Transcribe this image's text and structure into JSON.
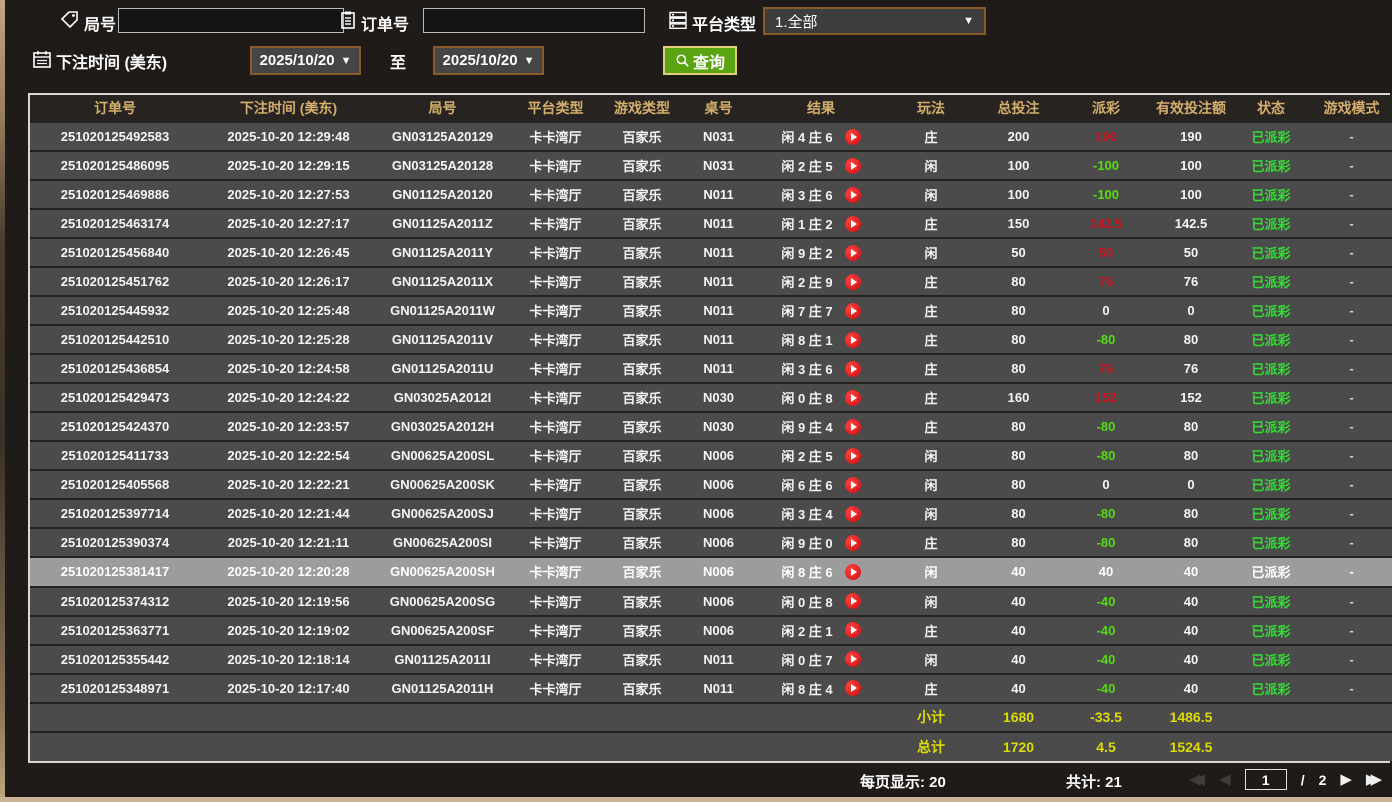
{
  "filters": {
    "round_label": "局号",
    "round_value": "",
    "order_label": "订单号",
    "order_value": "",
    "platform_label": "平台类型",
    "platform_value": "1.全部",
    "bet_time_label": "下注时间 (美东)",
    "date_from": "2025/10/20",
    "to_label": "至",
    "date_to": "2025/10/20",
    "query_label": "查询"
  },
  "table": {
    "columns": [
      "订单号",
      "下注时间 (美东)",
      "局号",
      "平台类型",
      "游戏类型",
      "桌号",
      "结果",
      "玩法",
      "总投注",
      "派彩",
      "有效投注额",
      "状态",
      "游戏模式"
    ],
    "rows": [
      {
        "order_id": "251020125492583",
        "bet_time": "2025-10-20 12:29:48",
        "round_id": "GN03125A20129",
        "platform": "卡卡湾厅",
        "game_type": "百家乐",
        "table_no": "N031",
        "result": "闲 4 庄 6",
        "play": "庄",
        "total_bet": "200",
        "payout": "190",
        "valid_bet": "190",
        "status": "已派彩",
        "game_mode": "-"
      },
      {
        "order_id": "251020125486095",
        "bet_time": "2025-10-20 12:29:15",
        "round_id": "GN03125A20128",
        "platform": "卡卡湾厅",
        "game_type": "百家乐",
        "table_no": "N031",
        "result": "闲 2 庄 5",
        "play": "闲",
        "total_bet": "100",
        "payout": "-100",
        "valid_bet": "100",
        "status": "已派彩",
        "game_mode": "-"
      },
      {
        "order_id": "251020125469886",
        "bet_time": "2025-10-20 12:27:53",
        "round_id": "GN01125A20120",
        "platform": "卡卡湾厅",
        "game_type": "百家乐",
        "table_no": "N011",
        "result": "闲 3 庄 6",
        "play": "闲",
        "total_bet": "100",
        "payout": "-100",
        "valid_bet": "100",
        "status": "已派彩",
        "game_mode": "-"
      },
      {
        "order_id": "251020125463174",
        "bet_time": "2025-10-20 12:27:17",
        "round_id": "GN01125A2011Z",
        "platform": "卡卡湾厅",
        "game_type": "百家乐",
        "table_no": "N011",
        "result": "闲 1 庄 2",
        "play": "庄",
        "total_bet": "150",
        "payout": "142.5",
        "valid_bet": "142.5",
        "status": "已派彩",
        "game_mode": "-"
      },
      {
        "order_id": "251020125456840",
        "bet_time": "2025-10-20 12:26:45",
        "round_id": "GN01125A2011Y",
        "platform": "卡卡湾厅",
        "game_type": "百家乐",
        "table_no": "N011",
        "result": "闲 9 庄 2",
        "play": "闲",
        "total_bet": "50",
        "payout": "50",
        "valid_bet": "50",
        "status": "已派彩",
        "game_mode": "-"
      },
      {
        "order_id": "251020125451762",
        "bet_time": "2025-10-20 12:26:17",
        "round_id": "GN01125A2011X",
        "platform": "卡卡湾厅",
        "game_type": "百家乐",
        "table_no": "N011",
        "result": "闲 2 庄 9",
        "play": "庄",
        "total_bet": "80",
        "payout": "76",
        "valid_bet": "76",
        "status": "已派彩",
        "game_mode": "-"
      },
      {
        "order_id": "251020125445932",
        "bet_time": "2025-10-20 12:25:48",
        "round_id": "GN01125A2011W",
        "platform": "卡卡湾厅",
        "game_type": "百家乐",
        "table_no": "N011",
        "result": "闲 7 庄 7",
        "play": "庄",
        "total_bet": "80",
        "payout": "0",
        "valid_bet": "0",
        "status": "已派彩",
        "game_mode": "-"
      },
      {
        "order_id": "251020125442510",
        "bet_time": "2025-10-20 12:25:28",
        "round_id": "GN01125A2011V",
        "platform": "卡卡湾厅",
        "game_type": "百家乐",
        "table_no": "N011",
        "result": "闲 8 庄 1",
        "play": "庄",
        "total_bet": "80",
        "payout": "-80",
        "valid_bet": "80",
        "status": "已派彩",
        "game_mode": "-"
      },
      {
        "order_id": "251020125436854",
        "bet_time": "2025-10-20 12:24:58",
        "round_id": "GN01125A2011U",
        "platform": "卡卡湾厅",
        "game_type": "百家乐",
        "table_no": "N011",
        "result": "闲 3 庄 6",
        "play": "庄",
        "total_bet": "80",
        "payout": "76",
        "valid_bet": "76",
        "status": "已派彩",
        "game_mode": "-"
      },
      {
        "order_id": "251020125429473",
        "bet_time": "2025-10-20 12:24:22",
        "round_id": "GN03025A2012I",
        "platform": "卡卡湾厅",
        "game_type": "百家乐",
        "table_no": "N030",
        "result": "闲 0 庄 8",
        "play": "庄",
        "total_bet": "160",
        "payout": "152",
        "valid_bet": "152",
        "status": "已派彩",
        "game_mode": "-"
      },
      {
        "order_id": "251020125424370",
        "bet_time": "2025-10-20 12:23:57",
        "round_id": "GN03025A2012H",
        "platform": "卡卡湾厅",
        "game_type": "百家乐",
        "table_no": "N030",
        "result": "闲 9 庄 4",
        "play": "庄",
        "total_bet": "80",
        "payout": "-80",
        "valid_bet": "80",
        "status": "已派彩",
        "game_mode": "-"
      },
      {
        "order_id": "251020125411733",
        "bet_time": "2025-10-20 12:22:54",
        "round_id": "GN00625A200SL",
        "platform": "卡卡湾厅",
        "game_type": "百家乐",
        "table_no": "N006",
        "result": "闲 2 庄 5",
        "play": "闲",
        "total_bet": "80",
        "payout": "-80",
        "valid_bet": "80",
        "status": "已派彩",
        "game_mode": "-"
      },
      {
        "order_id": "251020125405568",
        "bet_time": "2025-10-20 12:22:21",
        "round_id": "GN00625A200SK",
        "platform": "卡卡湾厅",
        "game_type": "百家乐",
        "table_no": "N006",
        "result": "闲 6 庄 6",
        "play": "闲",
        "total_bet": "80",
        "payout": "0",
        "valid_bet": "0",
        "status": "已派彩",
        "game_mode": "-"
      },
      {
        "order_id": "251020125397714",
        "bet_time": "2025-10-20 12:21:44",
        "round_id": "GN00625A200SJ",
        "platform": "卡卡湾厅",
        "game_type": "百家乐",
        "table_no": "N006",
        "result": "闲 3 庄 4",
        "play": "闲",
        "total_bet": "80",
        "payout": "-80",
        "valid_bet": "80",
        "status": "已派彩",
        "game_mode": "-"
      },
      {
        "order_id": "251020125390374",
        "bet_time": "2025-10-20 12:21:11",
        "round_id": "GN00625A200SI",
        "platform": "卡卡湾厅",
        "game_type": "百家乐",
        "table_no": "N006",
        "result": "闲 9 庄 0",
        "play": "庄",
        "total_bet": "80",
        "payout": "-80",
        "valid_bet": "80",
        "status": "已派彩",
        "game_mode": "-"
      },
      {
        "order_id": "251020125381417",
        "bet_time": "2025-10-20 12:20:28",
        "round_id": "GN00625A200SH",
        "platform": "卡卡湾厅",
        "game_type": "百家乐",
        "table_no": "N006",
        "result": "闲 8 庄 6",
        "play": "闲",
        "total_bet": "40",
        "payout": "40",
        "valid_bet": "40",
        "status": "已派彩",
        "game_mode": "-",
        "selected": true
      },
      {
        "order_id": "251020125374312",
        "bet_time": "2025-10-20 12:19:56",
        "round_id": "GN00625A200SG",
        "platform": "卡卡湾厅",
        "game_type": "百家乐",
        "table_no": "N006",
        "result": "闲 0 庄 8",
        "play": "闲",
        "total_bet": "40",
        "payout": "-40",
        "valid_bet": "40",
        "status": "已派彩",
        "game_mode": "-"
      },
      {
        "order_id": "251020125363771",
        "bet_time": "2025-10-20 12:19:02",
        "round_id": "GN00625A200SF",
        "platform": "卡卡湾厅",
        "game_type": "百家乐",
        "table_no": "N006",
        "result": "闲 2 庄 1",
        "play": "庄",
        "total_bet": "40",
        "payout": "-40",
        "valid_bet": "40",
        "status": "已派彩",
        "game_mode": "-"
      },
      {
        "order_id": "251020125355442",
        "bet_time": "2025-10-20 12:18:14",
        "round_id": "GN01125A2011I",
        "platform": "卡卡湾厅",
        "game_type": "百家乐",
        "table_no": "N011",
        "result": "闲 0 庄 7",
        "play": "闲",
        "total_bet": "40",
        "payout": "-40",
        "valid_bet": "40",
        "status": "已派彩",
        "game_mode": "-"
      },
      {
        "order_id": "251020125348971",
        "bet_time": "2025-10-20 12:17:40",
        "round_id": "GN01125A2011H",
        "platform": "卡卡湾厅",
        "game_type": "百家乐",
        "table_no": "N011",
        "result": "闲 8 庄 4",
        "play": "庄",
        "total_bet": "40",
        "payout": "-40",
        "valid_bet": "40",
        "status": "已派彩",
        "game_mode": "-"
      }
    ],
    "summary_rows": [
      {
        "label": "小计",
        "total_bet": "1680",
        "payout": "-33.5",
        "valid_bet": "1486.5"
      },
      {
        "label": "总计",
        "total_bet": "1720",
        "payout": "4.5",
        "valid_bet": "1524.5"
      }
    ]
  },
  "pagination": {
    "per_page_label": "每页显示: 20",
    "total_label": "共计: 21",
    "current_page": "1",
    "separator": "/",
    "total_pages": "2"
  },
  "colors": {
    "header_text": "#d4ae6a",
    "payout_positive": "#cc1420",
    "payout_negative": "#55dd11",
    "status_settled": "#33dd33",
    "summary_text": "#dddd00",
    "button_green": "#5aa412",
    "picker_border": "#8a5a28"
  }
}
